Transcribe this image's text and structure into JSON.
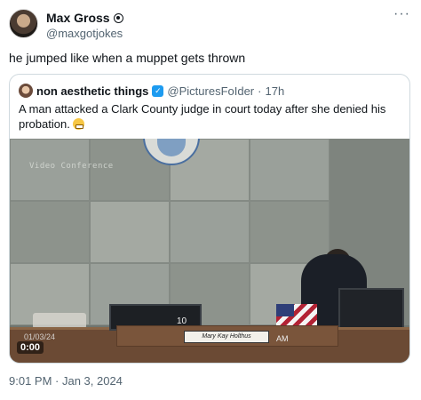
{
  "tweet": {
    "author": {
      "display_name": "Max Gross",
      "handle": "@maxgotjokes",
      "badge_icon": "badge-icon"
    },
    "text": "he jumped like when a muppet gets thrown",
    "more_icon": "more-icon",
    "timestamp": "9:01 PM · Jan 3, 2024"
  },
  "quoted_tweet": {
    "author": {
      "display_name": "non aesthetic things",
      "verified_icon": "verified-icon",
      "handle": "@PicturesFoIder",
      "separator": "·",
      "time": "17h"
    },
    "text": "A man attacked a Clark County judge in court today after she denied his probation.",
    "emoji": "grimacing-face-emoji",
    "video": {
      "overlay_label": "Video Conference",
      "bench_number": "10",
      "nameplate": "Mary Kay Holthus",
      "overlay_time": "AM",
      "overlay_date": "01/03/24",
      "timer": "0:00"
    }
  },
  "colors": {
    "text_primary": "#0f1419",
    "text_secondary": "#536471",
    "border": "#cfd9de",
    "verified_blue": "#1d9bf0"
  }
}
